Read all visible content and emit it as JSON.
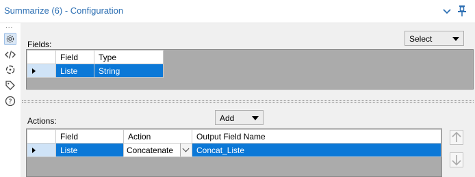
{
  "window": {
    "title": "Summarize (6) - Configuration"
  },
  "fields_section": {
    "label": "Fields:",
    "select_dropdown": "Select",
    "columns": [
      "Field",
      "Type"
    ],
    "rows": [
      {
        "field": "Liste",
        "type": "String"
      }
    ]
  },
  "actions_section": {
    "label": "Actions:",
    "add_dropdown": "Add",
    "columns": [
      "Field",
      "Action",
      "Output Field Name"
    ],
    "rows": [
      {
        "field": "Liste",
        "action": "Concatenate",
        "output_field_name": "Concat_Liste"
      }
    ]
  },
  "rail_icons": [
    "gear-icon",
    "code-icon",
    "refresh-icon",
    "tag-icon",
    "help-icon"
  ],
  "colors": {
    "title": "#2c6fb3",
    "selection": "#0b78d7",
    "row_header": "#cfe3f7",
    "grid_bg": "#ababab"
  }
}
